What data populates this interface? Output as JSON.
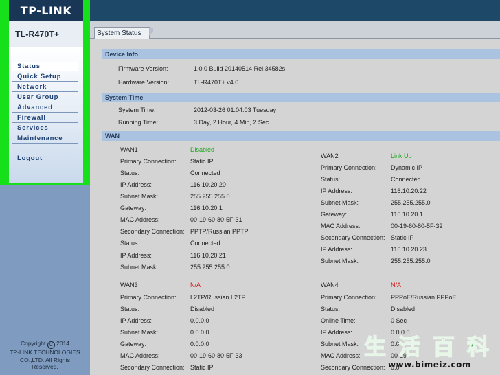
{
  "brand": {
    "logo": "TP-LINK",
    "model": "TL-R470T+"
  },
  "menu": [
    {
      "label": "Status"
    },
    {
      "label": "Quick Setup"
    },
    {
      "label": "Network"
    },
    {
      "label": "User Group"
    },
    {
      "label": "Advanced"
    },
    {
      "label": "Firewall"
    },
    {
      "label": "Services"
    },
    {
      "label": "Maintenance"
    },
    {
      "label": "Logout"
    }
  ],
  "copyright": {
    "line1": "Copyright",
    "symbol": "C",
    "year": "2014",
    "line2": "TP-LINK TECHNOLOGIES",
    "line3": "CO.,LTD. All Rights",
    "line4": "Reserved."
  },
  "tab": {
    "label": "System Status"
  },
  "device_info": {
    "title": "Device Info",
    "firmware_label": "Firmware Version:",
    "firmware_value": "1.0.0 Build 20140514 Rel.34582s",
    "hardware_label": "Hardware Version:",
    "hardware_value": "TL-R470T+ v4.0"
  },
  "system_time": {
    "title": "System Time",
    "time_label": "System Time:",
    "time_value": "2012-03-26 01:04:03 Tuesday",
    "running_label": "Running Time:",
    "running_value": "3 Day, 2 Hour, 4 Min, 2 Sec"
  },
  "wan": {
    "title": "WAN",
    "wan1": {
      "name": "WAN1",
      "status": "Disabled",
      "rows": [
        [
          "Primary Connection:",
          "Static IP"
        ],
        [
          "Status:",
          "Connected"
        ],
        [
          "IP Address:",
          "116.10.20.20"
        ],
        [
          "Subnet Mask:",
          "255.255.255.0"
        ],
        [
          "Gateway:",
          "116.10.20.1"
        ],
        [
          "MAC Address:",
          "00-19-60-80-5F-31"
        ],
        [
          "Secondary Connection:",
          "PPTP/Russian PPTP"
        ],
        [
          "Status:",
          "Connected"
        ],
        [
          "IP Address:",
          "116.10.20.21"
        ],
        [
          "Subnet Mask:",
          "255.255.255.0"
        ]
      ]
    },
    "wan2": {
      "name": "WAN2",
      "status": "Link Up",
      "rows": [
        [
          "Primary Connection:",
          "Dynamic IP"
        ],
        [
          "Status:",
          "Connected"
        ],
        [
          "IP Address:",
          "116.10.20.22"
        ],
        [
          "Subnet Mask:",
          "255.255.255.0"
        ],
        [
          "Gateway:",
          "116.10.20.1"
        ],
        [
          "MAC Address:",
          "00-19-60-80-5F-32"
        ],
        [
          "Secondary Connection:",
          "Static IP"
        ],
        [
          "IP Address:",
          "116.10.20.23"
        ],
        [
          "Subnet Mask:",
          "255.255.255.0"
        ]
      ]
    },
    "wan3": {
      "name": "WAN3",
      "status": "N/A",
      "rows": [
        [
          "Primary Connection:",
          "L2TP/Russian L2TP"
        ],
        [
          "Status:",
          "Disabled"
        ],
        [
          "IP Address:",
          "0.0.0.0"
        ],
        [
          "Subnet Mask:",
          "0.0.0.0"
        ],
        [
          "Gateway:",
          "0.0.0.0"
        ],
        [
          "MAC Address:",
          "00-19-60-80-5F-33"
        ],
        [
          "Secondary Connection:",
          "Static IP"
        ]
      ]
    },
    "wan4": {
      "name": "WAN4",
      "status": "N/A",
      "rows": [
        [
          "Primary Connection:",
          "PPPoE/Russian PPPoE"
        ],
        [
          "Status:",
          "Disabled"
        ],
        [
          "Online Time:",
          "0 Sec"
        ],
        [
          "IP Address:",
          "0.0.0.0"
        ],
        [
          "Subnet Mask:",
          "0.0"
        ],
        [
          "MAC Address:",
          "00-19"
        ],
        [
          "Secondary Connection:",
          "0.0"
        ]
      ]
    }
  },
  "watermark": {
    "chars": [
      "生",
      "活",
      "百",
      "科"
    ],
    "url": "www.bimeiz.com"
  },
  "colors": {
    "sidebar_highlight": "#15e01a",
    "banner": "#1d4867",
    "link_up": "#18a51a",
    "na": "#d81818"
  }
}
